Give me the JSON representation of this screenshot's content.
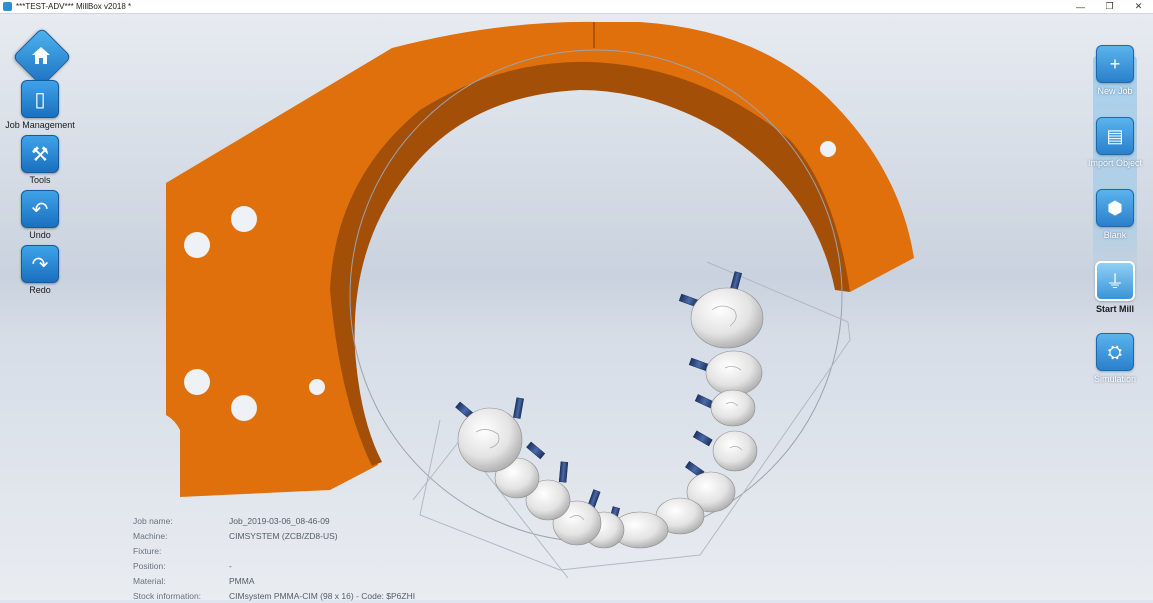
{
  "window": {
    "title": "***TEST-ADV*** MillBox v2018 *",
    "minimize_glyph": "—",
    "restore_glyph": "❐",
    "close_glyph": "✕"
  },
  "left_toolbar": {
    "home_icon": "home-icon",
    "items": [
      {
        "label": "Job Management",
        "icon": "job-management-icon",
        "glyph": "▯"
      },
      {
        "label": "Tools",
        "icon": "tools-icon",
        "glyph": "⚒"
      },
      {
        "label": "Undo",
        "icon": "undo-icon",
        "glyph": "↶"
      },
      {
        "label": "Redo",
        "icon": "redo-icon",
        "glyph": "↷"
      }
    ]
  },
  "right_toolbar": {
    "items": [
      {
        "label": "New Job",
        "icon": "new-job-icon",
        "glyph": "+"
      },
      {
        "label": "Import Object",
        "icon": "import-object-icon",
        "glyph": "▤"
      },
      {
        "label": "Blank",
        "icon": "blank-icon",
        "glyph": "⬢"
      },
      {
        "label": "Start Mill",
        "icon": "start-mill-icon",
        "glyph": "⏚",
        "active": true
      },
      {
        "label": "Simulation",
        "icon": "simulation-icon",
        "glyph": "⛭"
      }
    ]
  },
  "job_info": [
    {
      "label": "Job name:",
      "value": "Job_2019-03-06_08-46-09"
    },
    {
      "label": "Machine:",
      "value": "CIMSYSTEM (ZCB/ZD8-US)"
    },
    {
      "label": "Fixture:",
      "value": ""
    },
    {
      "label": "Position:",
      "value": "-"
    },
    {
      "label": "Material:",
      "value": "PMMA"
    },
    {
      "label": "Stock information:",
      "value": "CIMsystem PMMA-CIM (98 x 16) - Code: $P6ZHI"
    }
  ],
  "colors": {
    "fixture": "#e0700b",
    "fixture_dark": "#9c4a06",
    "toolbar_accent": "#2a80cc",
    "tooth": "#e6e6e6",
    "sprue": "#2e4a86"
  }
}
